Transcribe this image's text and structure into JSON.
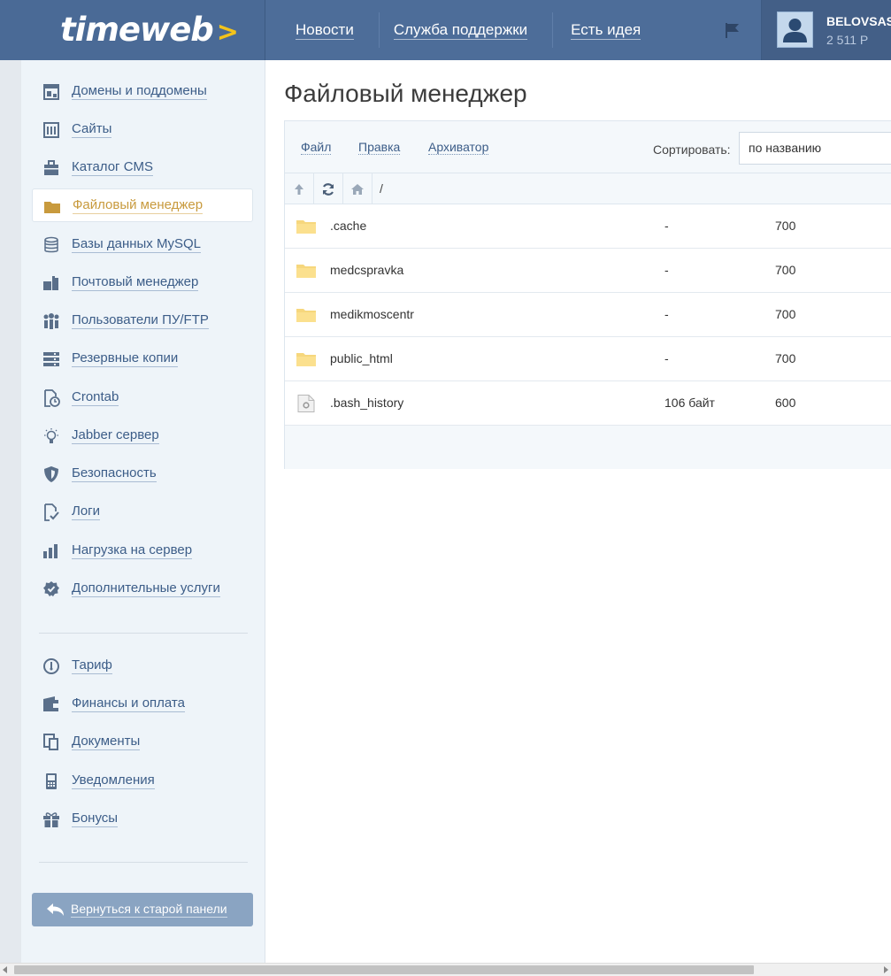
{
  "header": {
    "logo": "timeweb",
    "logo_arrow": ">",
    "nav": [
      "Новости",
      "Служба поддержки",
      "Есть идея"
    ],
    "user": {
      "name": "BELOVSAS",
      "balance": "2 511 Р"
    }
  },
  "sidebar": {
    "items": [
      {
        "label": "Домены и поддомены",
        "icon": "domains-icon"
      },
      {
        "label": "Сайты",
        "icon": "sites-icon"
      },
      {
        "label": "Каталог CMS",
        "icon": "briefcase-icon"
      },
      {
        "label": "Файловый менеджер",
        "icon": "folder-icon",
        "active": true
      },
      {
        "label": "Базы данных MySQL",
        "icon": "database-icon"
      },
      {
        "label": "Почтовый менеджер",
        "icon": "mail-icon"
      },
      {
        "label": "Пользователи ПУ/FTP",
        "icon": "users-icon"
      },
      {
        "label": "Резервные копии",
        "icon": "backup-icon"
      },
      {
        "label": "Crontab",
        "icon": "crontab-icon"
      },
      {
        "label": "Jabber сервер",
        "icon": "lightbulb-icon"
      },
      {
        "label": "Безопасность",
        "icon": "shield-icon"
      },
      {
        "label": "Логи",
        "icon": "logs-icon"
      },
      {
        "label": "Нагрузка на сервер",
        "icon": "bar-chart-icon"
      },
      {
        "label": "Дополнительные услуги",
        "icon": "badge-icon"
      }
    ],
    "items2": [
      {
        "label": "Тариф",
        "icon": "gauge-icon"
      },
      {
        "label": "Финансы и оплата",
        "icon": "wallet-icon"
      },
      {
        "label": "Документы",
        "icon": "documents-icon"
      },
      {
        "label": "Уведомления",
        "icon": "phone-icon"
      },
      {
        "label": "Бонусы",
        "icon": "gift-icon"
      }
    ],
    "back_button": "Вернуться к старой панели"
  },
  "main": {
    "title": "Файловый менеджер",
    "menu": [
      "Файл",
      "Правка",
      "Архиватор"
    ],
    "sort_label": "Сортировать:",
    "sort_value": "по названию",
    "path": "/",
    "files": [
      {
        "name": ".cache",
        "size": "-",
        "perm": "700",
        "type": "folder"
      },
      {
        "name": "medcspravka",
        "size": "-",
        "perm": "700",
        "type": "folder"
      },
      {
        "name": "medikmoscentr",
        "size": "-",
        "perm": "700",
        "type": "folder"
      },
      {
        "name": "public_html",
        "size": "-",
        "perm": "700",
        "type": "folder"
      },
      {
        "name": ".bash_history",
        "size": "106 байт",
        "perm": "600",
        "type": "file"
      }
    ]
  },
  "colors": {
    "header_bg": "#4d6d99",
    "sidebar_bg": "#eef4f9",
    "link": "#3c5d88",
    "active": "#c89a3d",
    "folder": "#f6d77d",
    "logo_accent": "#f3c31a"
  }
}
